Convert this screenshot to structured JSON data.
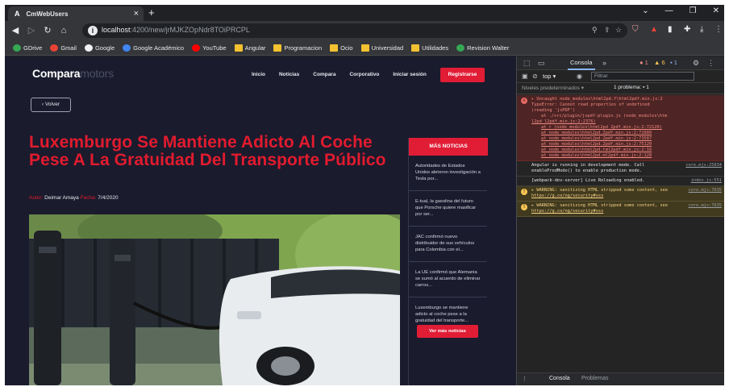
{
  "browser": {
    "tab_title": "CmWebUsers",
    "tab_icon_letter": "A",
    "close_glyph": "×",
    "new_tab_glyph": "+",
    "url_host": "localhost",
    "url_path": ":4200/new/jrMJKZOpNdr8TOiPRCPL",
    "bookmarks": [
      {
        "label": "GDrive",
        "icon": "gdrive-icon",
        "color": "#34a853"
      },
      {
        "label": "Gmail",
        "icon": "gmail-icon",
        "color": "#ea4335"
      },
      {
        "label": "Google",
        "icon": "google-icon",
        "color": "#f2f2f2"
      },
      {
        "label": "Google Académico",
        "icon": "scholar-icon",
        "color": "#4285f4"
      },
      {
        "label": "YouTube",
        "icon": "youtube-icon",
        "color": "#ff0000"
      },
      {
        "label": "Angular",
        "icon": "folder-icon",
        "color": "#f2c230"
      },
      {
        "label": "Programacion",
        "icon": "folder-icon",
        "color": "#f2c230"
      },
      {
        "label": "Ocio",
        "icon": "folder-icon",
        "color": "#f2c230"
      },
      {
        "label": "Universidad",
        "icon": "folder-icon",
        "color": "#f2c230"
      },
      {
        "label": "Utilidades",
        "icon": "folder-icon",
        "color": "#f2c230"
      },
      {
        "label": "Revision Walter",
        "icon": "globe-icon",
        "color": "#34a853"
      }
    ]
  },
  "site": {
    "brand_a": "Compara",
    "brand_b": "motors",
    "nav": [
      "Inicio",
      "Noticias",
      "Compara",
      "Corporativo",
      "Iniciar sesión"
    ],
    "register": "Registrarse",
    "back": "Volver",
    "article": {
      "title": "Luxemburgo Se Mantiene Adicto Al Coche Pese A La Gratuidad Del Transporte Público",
      "author_label": "Autor:",
      "author": "Deimar Amaya",
      "date_label": "Fecha:",
      "date": "7/4/2020"
    },
    "sidebar": {
      "heading": "MÁS NOTICIAS",
      "items": [
        "Autoridades de Estados Unidos abrieron investigación a Tesla por...",
        "E-tual, la gasolina del futuro que Porsche quiere masificar por ser...",
        "JAC confirmó nuevo distribuidor de sus vehículos para Colombia con el...",
        "La UE confirmó que Alemania se sumó al acuerdo de eliminar carros...",
        "Luxemburgo se mantiene adicto al coche pese a la gratuidad del transporte..."
      ],
      "more_button": "Ver más noticias"
    }
  },
  "devtools": {
    "tab_console": "Consola",
    "more": "»",
    "errors": "1",
    "warnings": "6",
    "infos": "1",
    "context": "top ▾",
    "filter_placeholder": "Filtrar",
    "levels": "Niveles predeterminados ▾",
    "issues": "1 problema: ▪ 1",
    "drawer_console": "Consola",
    "drawer_issues": "Problemas",
    "error": {
      "line1": "▸ Uncaught  node_modules\\html2pd.f\\html2pdf.min.js:2",
      "line2": "TypeError: Cannot read properties of undefined",
      "line3": "(reading 'jsPDF')",
      "line4": "at ./src/plugin/jspdf-plugin.js (node_modules\\htm",
      "line5": "l2pd_l2pdf.min.js:2:2376)",
      "stack": [
        "at r (node_modules\\html2pd_2pdf.min.js:2:72120)",
        "at node_modules\\html2pd.2pdf.min.js:2:72880",
        "at node_modules\\html2pd.2pdf.min.js:2:73587",
        "at node_modules\\html2pd.2pdf.min.js:2:75120",
        "at node_modules\\html2pd.tml2pdf.min.js:2:16",
        "at node_modules\\html2pd.ml2pdf.min.js:2:128"
      ]
    },
    "info1": {
      "text": "Angular is running in development mode. Call enableProdMode() to enable production mode.",
      "src": "core.mjs:25834"
    },
    "info2": {
      "text": "[webpack-dev-server] Live Reloading enabled.",
      "src": "index.js:551"
    },
    "warn1": {
      "text": "▸ WARNING: sanitizing HTML stripped some content, see",
      "link": "https://g.co/ng/security#xss",
      "src": "core.mjs:7635"
    },
    "warn2": {
      "text": "▸ WARNING: sanitizing HTML stripped some content, see",
      "link": "https://g.co/ng/security#xss",
      "src": "core.mjs:7635"
    }
  }
}
